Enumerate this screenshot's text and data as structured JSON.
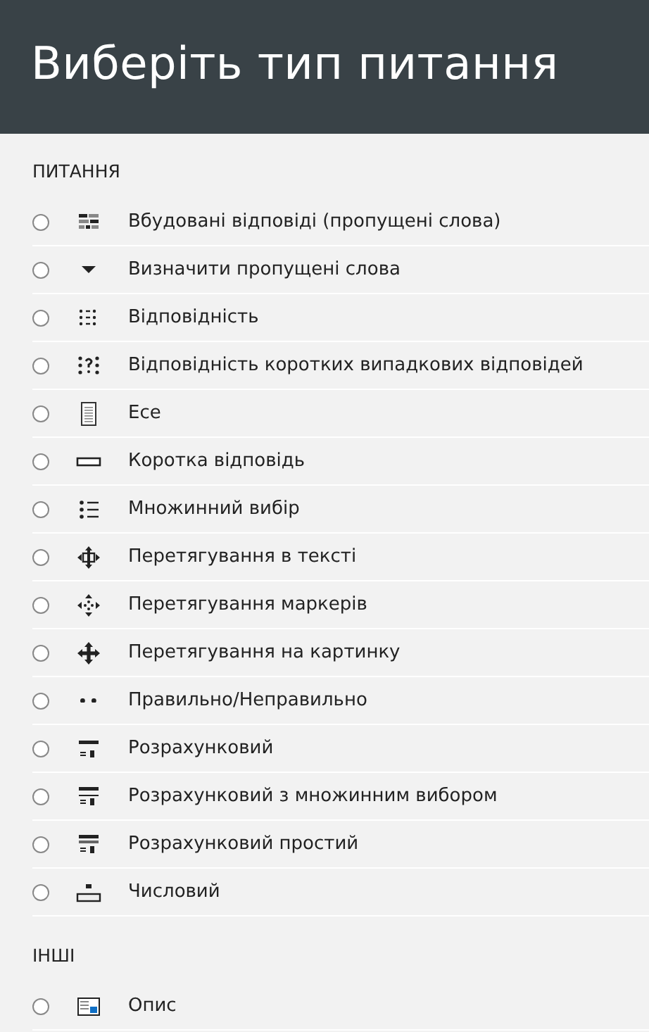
{
  "header": {
    "title": "Виберіть тип питання"
  },
  "sections": [
    {
      "heading": "ПИТАННЯ",
      "items": [
        {
          "label": "Вбудовані відповіді (пропущені слова)",
          "kind": "gapfill",
          "selected": false
        },
        {
          "label": "Визначити пропущені слова",
          "kind": "dropdown",
          "selected": false
        },
        {
          "label": "Відповідність",
          "kind": "matching",
          "selected": false
        },
        {
          "label": "Відповідність коротких випадкових відповідей",
          "kind": "randommatch",
          "selected": false
        },
        {
          "label": "Есе",
          "kind": "essay",
          "selected": false
        },
        {
          "label": "Коротка відповідь",
          "kind": "shortanswer",
          "selected": false
        },
        {
          "label": "Множинний вибір",
          "kind": "multichoice",
          "selected": false
        },
        {
          "label": "Перетягування в тексті",
          "kind": "dragtext",
          "selected": false
        },
        {
          "label": "Перетягування маркерів",
          "kind": "dragmarker",
          "selected": false
        },
        {
          "label": "Перетягування на картинку",
          "kind": "dragimage",
          "selected": false
        },
        {
          "label": "Правильно/Неправильно",
          "kind": "truefalse",
          "selected": false
        },
        {
          "label": "Розрахунковий",
          "kind": "calculated",
          "selected": false
        },
        {
          "label": "Розрахунковий з множинним вибором",
          "kind": "calcmulti",
          "selected": false
        },
        {
          "label": "Розрахунковий простий",
          "kind": "calcsimple",
          "selected": false
        },
        {
          "label": "Числовий",
          "kind": "numerical",
          "selected": false
        }
      ]
    },
    {
      "heading": "ІНШІ",
      "items": [
        {
          "label": "Опис",
          "kind": "description",
          "selected": false
        }
      ]
    }
  ]
}
